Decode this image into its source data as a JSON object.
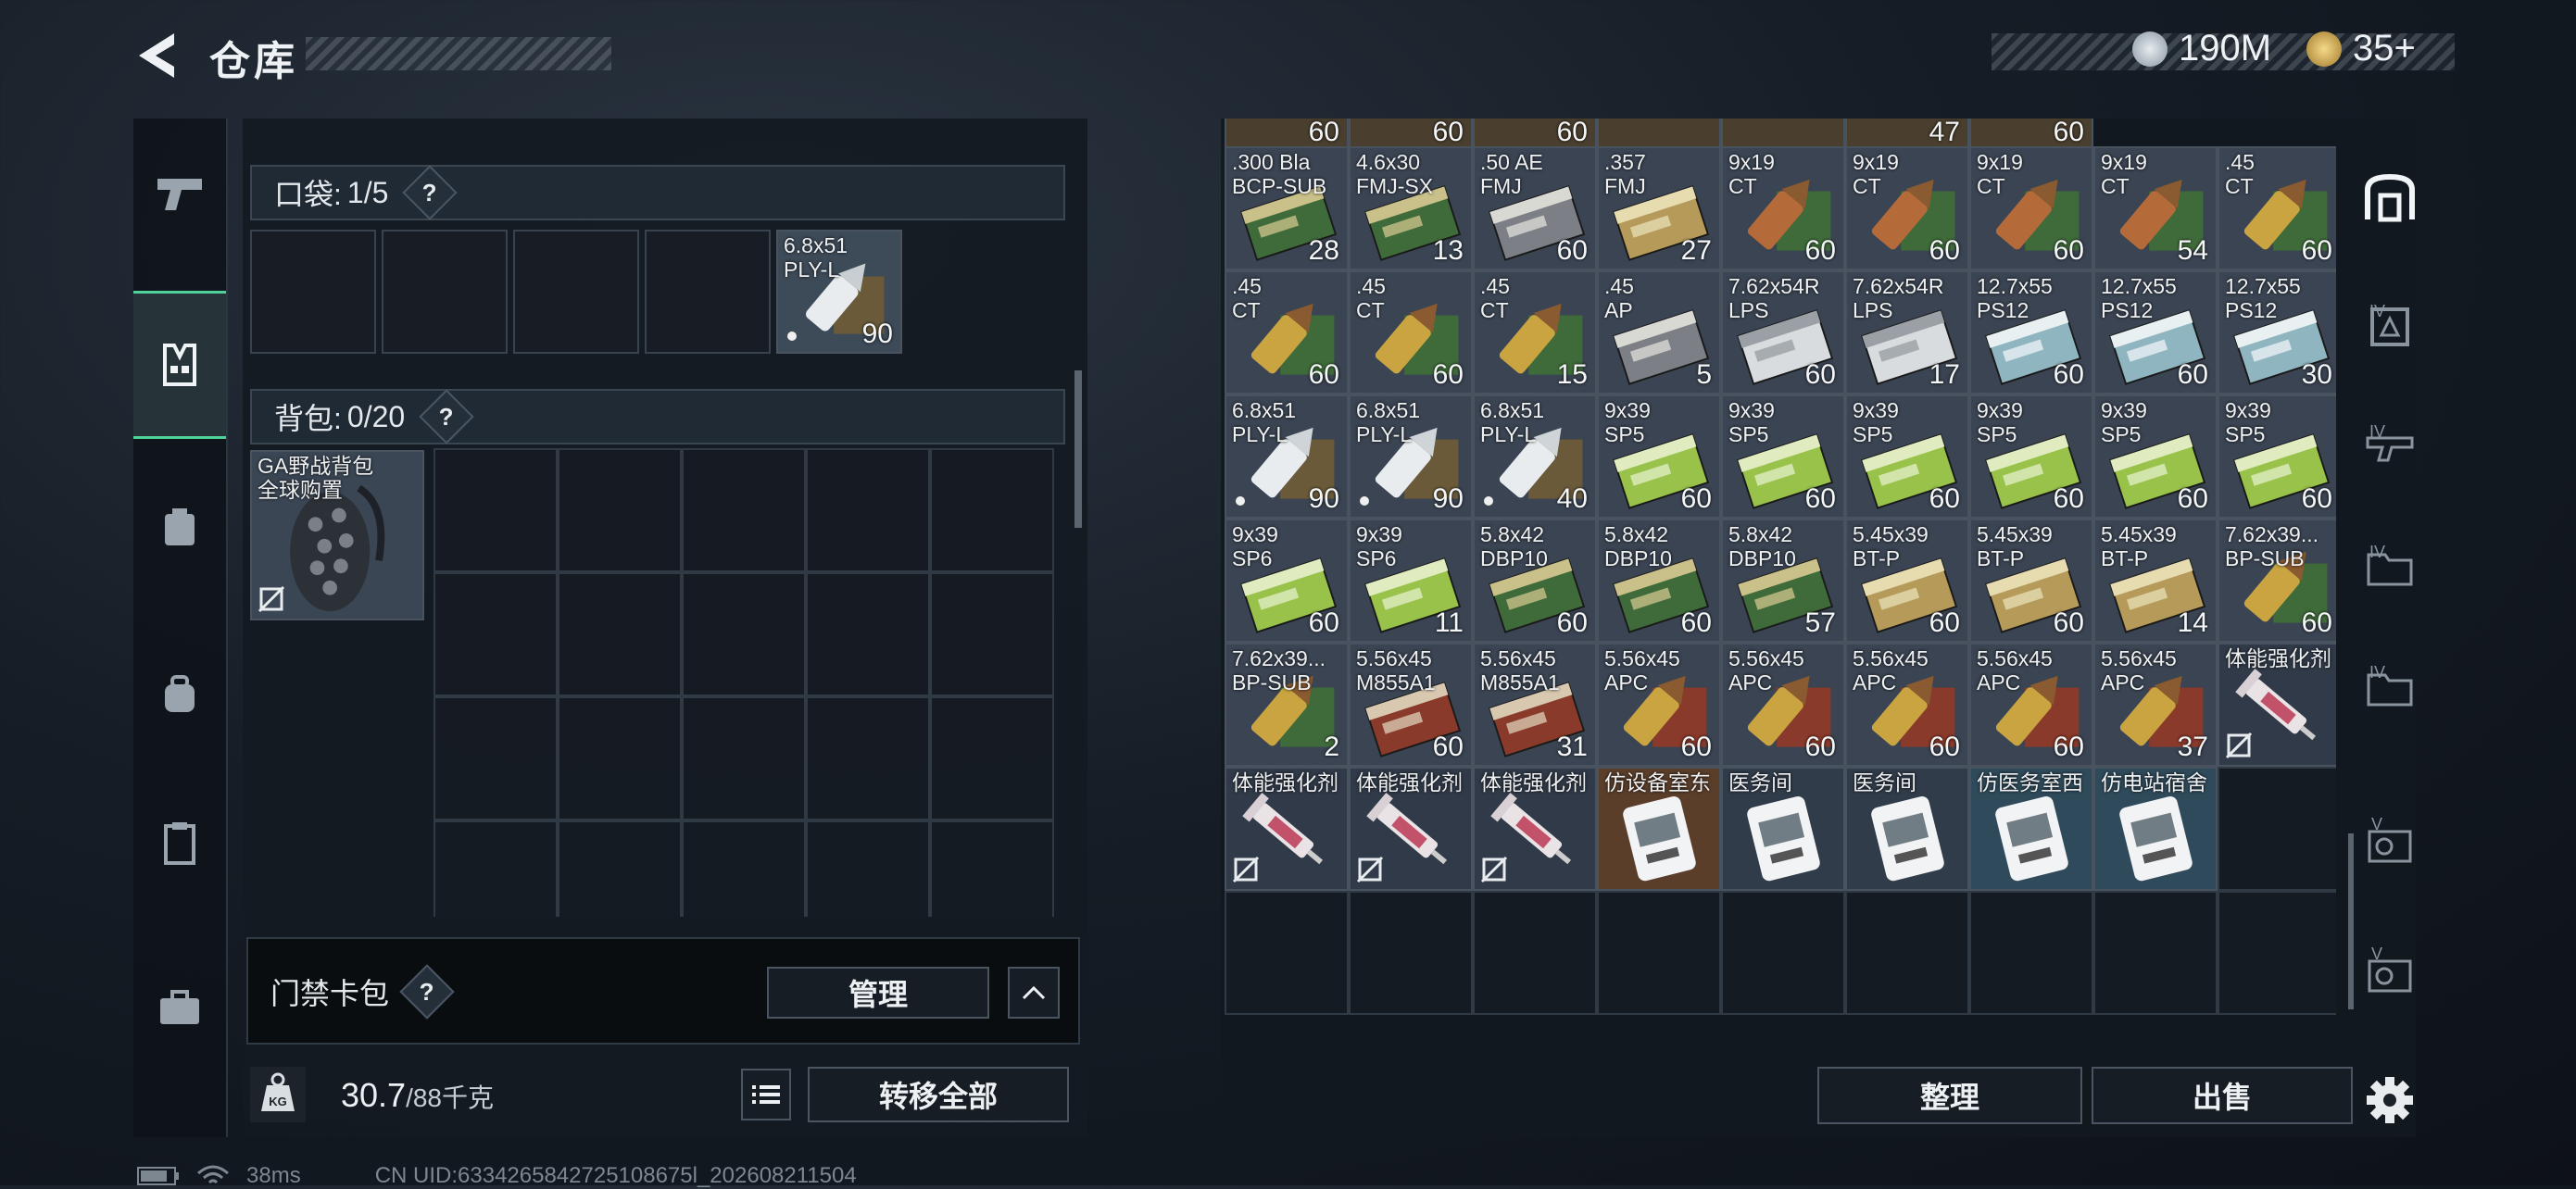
{
  "header": {
    "title": "仓库",
    "currencies": [
      {
        "icon": "silver-coin-icon",
        "value": "190M"
      },
      {
        "icon": "gold-coin-icon",
        "value": "35+"
      }
    ]
  },
  "left_nav": [
    {
      "icon": "pistol-icon",
      "active": false
    },
    {
      "icon": "vest-icon",
      "active": true
    },
    {
      "icon": "helmet-icon",
      "active": false
    },
    {
      "icon": "backpack-icon",
      "active": false
    },
    {
      "icon": "clipboard-icon",
      "active": false
    },
    {
      "icon": "briefcase-icon",
      "active": false
    }
  ],
  "pockets": {
    "label": "口袋:",
    "count": "1/5",
    "help": "?",
    "items": [
      {
        "name": "6.8x51\nPLY-L",
        "qty": "90"
      }
    ]
  },
  "backpack": {
    "label": "背包:",
    "count": "0/20",
    "help": "?",
    "equipped": {
      "name": "GA野战背包\n全球购置"
    }
  },
  "keycard": {
    "label": "门禁卡包",
    "help": "?",
    "manage_label": "管理",
    "collapse_icon": "chevron-up-icon"
  },
  "footer": {
    "weight": "30.7",
    "capacity": "/88千克",
    "transfer_all_label": "转移全部",
    "sort_label": "整理",
    "sell_label": "出售"
  },
  "status_bar": {
    "ping": "38ms",
    "uid": "CN UID:6334265842725108675l_202608211504"
  },
  "stash_top_quantities": [
    "60",
    "60",
    "60",
    "",
    "",
    "47",
    "60"
  ],
  "stash_items": [
    {
      "name": ".300 Bla\nBCP-SUB",
      "qty": "28",
      "kind": "ammo-green"
    },
    {
      "name": "4.6x30\nFMJ-SX",
      "qty": "13",
      "kind": "ammo-green"
    },
    {
      "name": ".50 AE\nFMJ",
      "qty": "60",
      "kind": "ammo-gray"
    },
    {
      "name": ".357\nFMJ",
      "qty": "27",
      "kind": "ammo-tan"
    },
    {
      "name": "9x19\nCT",
      "qty": "60",
      "kind": "round-copper"
    },
    {
      "name": "9x19\nCT",
      "qty": "60",
      "kind": "round-copper"
    },
    {
      "name": "9x19\nCT",
      "qty": "60",
      "kind": "round-copper"
    },
    {
      "name": "9x19\nCT",
      "qty": "54",
      "kind": "round-copper"
    },
    {
      "name": ".45\nCT",
      "qty": "60",
      "kind": "round-brass"
    },
    {
      "name": ".45\nCT",
      "qty": "60",
      "kind": "round-brass"
    },
    {
      "name": ".45\nCT",
      "qty": "60",
      "kind": "round-brass"
    },
    {
      "name": ".45\nCT",
      "qty": "15",
      "kind": "round-brass"
    },
    {
      "name": ".45\nAP",
      "qty": "5",
      "kind": "ammo-gray"
    },
    {
      "name": "7.62x54R\nLPS",
      "qty": "60",
      "kind": "ammo-white"
    },
    {
      "name": "7.62x54R\nLPS",
      "qty": "17",
      "kind": "ammo-white"
    },
    {
      "name": "12.7x55\nPS12",
      "qty": "60",
      "kind": "ammo-blue"
    },
    {
      "name": "12.7x55\nPS12",
      "qty": "60",
      "kind": "ammo-blue"
    },
    {
      "name": "12.7x55\nPS12",
      "qty": "30",
      "kind": "ammo-blue"
    },
    {
      "name": "6.8x51\nPLY-L",
      "qty": "90",
      "kind": "round-white"
    },
    {
      "name": "6.8x51\nPLY-L",
      "qty": "90",
      "kind": "round-white"
    },
    {
      "name": "6.8x51\nPLY-L",
      "qty": "40",
      "kind": "round-white"
    },
    {
      "name": "9x39\nSP5",
      "qty": "60",
      "kind": "ammo-lime"
    },
    {
      "name": "9x39\nSP5",
      "qty": "60",
      "kind": "ammo-lime"
    },
    {
      "name": "9x39\nSP5",
      "qty": "60",
      "kind": "ammo-lime"
    },
    {
      "name": "9x39\nSP5",
      "qty": "60",
      "kind": "ammo-lime"
    },
    {
      "name": "9x39\nSP5",
      "qty": "60",
      "kind": "ammo-lime"
    },
    {
      "name": "9x39\nSP5",
      "qty": "60",
      "kind": "ammo-lime"
    },
    {
      "name": "9x39\nSP6",
      "qty": "60",
      "kind": "ammo-lime"
    },
    {
      "name": "9x39\nSP6",
      "qty": "11",
      "kind": "ammo-lime"
    },
    {
      "name": "5.8x42\nDBP10",
      "qty": "60",
      "kind": "ammo-green"
    },
    {
      "name": "5.8x42\nDBP10",
      "qty": "60",
      "kind": "ammo-green"
    },
    {
      "name": "5.8x42\nDBP10",
      "qty": "57",
      "kind": "ammo-green"
    },
    {
      "name": "5.45x39\nBT-P",
      "qty": "60",
      "kind": "ammo-tan"
    },
    {
      "name": "5.45x39\nBT-P",
      "qty": "60",
      "kind": "ammo-tan"
    },
    {
      "name": "5.45x39\nBT-P",
      "qty": "14",
      "kind": "ammo-tan"
    },
    {
      "name": "7.62x39...\nBP-SUB",
      "qty": "60",
      "kind": "round-brass"
    },
    {
      "name": "7.62x39...\nBP-SUB",
      "qty": "2",
      "kind": "round-brass"
    },
    {
      "name": "5.56x45\nM855A1",
      "qty": "60",
      "kind": "ammo-red"
    },
    {
      "name": "5.56x45\nM855A1",
      "qty": "31",
      "kind": "ammo-red"
    },
    {
      "name": "5.56x45\nAPC",
      "qty": "60",
      "kind": "round-brass-red"
    },
    {
      "name": "5.56x45\nAPC",
      "qty": "60",
      "kind": "round-brass-red"
    },
    {
      "name": "5.56x45\nAPC",
      "qty": "60",
      "kind": "round-brass-red"
    },
    {
      "name": "5.56x45\nAPC",
      "qty": "60",
      "kind": "round-brass-red"
    },
    {
      "name": "5.56x45\nAPC",
      "qty": "37",
      "kind": "round-brass-red"
    },
    {
      "name": "体能强化剂",
      "qty": "",
      "kind": "syringe"
    },
    {
      "name": "体能强化剂",
      "qty": "",
      "kind": "syringe"
    },
    {
      "name": "体能强化剂",
      "qty": "",
      "kind": "syringe"
    },
    {
      "name": "体能强化剂",
      "qty": "",
      "kind": "syringe"
    },
    {
      "name": "仿设备室东",
      "qty": "",
      "kind": "keycard-orange"
    },
    {
      "name": "医务间",
      "qty": "",
      "kind": "keycard"
    },
    {
      "name": "医务间",
      "qty": "",
      "kind": "keycard"
    },
    {
      "name": "仿医务室西",
      "qty": "",
      "kind": "keycard-blue"
    },
    {
      "name": "仿电站宿舍",
      "qty": "",
      "kind": "keycard-blue"
    }
  ],
  "right_nav": [
    {
      "icon": "stash-icon",
      "label": ""
    },
    {
      "icon": "storage-tier-icon",
      "label": "IV"
    },
    {
      "icon": "gun-rack-icon",
      "label": "IV"
    },
    {
      "icon": "folder-icon",
      "label": "IV"
    },
    {
      "icon": "folder-icon",
      "label": "IV"
    },
    {
      "icon": "medical-box-icon",
      "label": "V"
    },
    {
      "icon": "medical-box-icon",
      "label": "V"
    }
  ],
  "settings_icon": "gear-icon",
  "colors": {
    "accent": "#4fd19a",
    "panel": "#141a22",
    "border": "#3a4652"
  }
}
